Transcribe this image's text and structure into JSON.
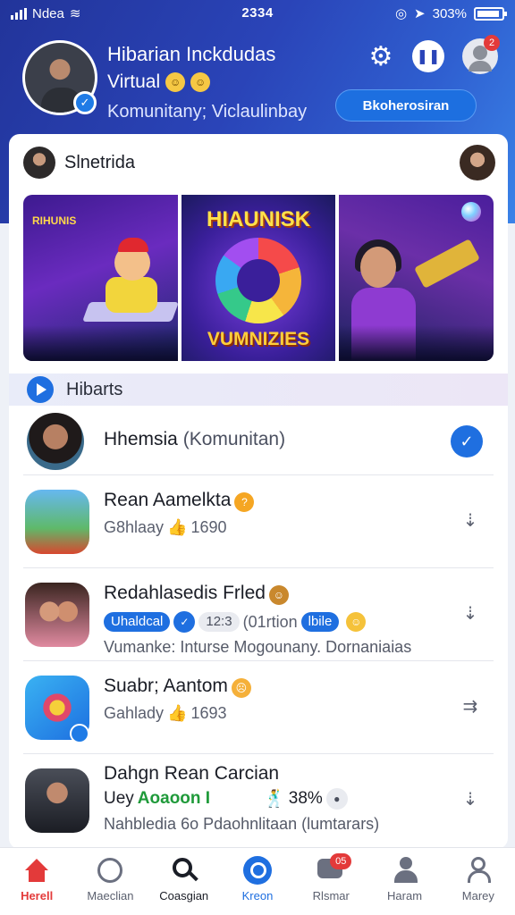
{
  "status": {
    "carrier": "Ndea",
    "time": "2334",
    "battery": "303%"
  },
  "profile": {
    "name": "Hibarian Inckdudas",
    "subtitle": "Virtual",
    "community": "Komunitany; Viclaulinbay",
    "action_label": "Bkoherosiran",
    "notification_count": "2"
  },
  "feed": {
    "author": "Slnetrida",
    "banner": {
      "panel1_label": "RIHUNIS",
      "panel2_title": "HIAUNISK",
      "panel2_subtitle": "VUMNIZIES"
    },
    "section_label": "Hibarts"
  },
  "list": [
    {
      "title": "Hhemsia",
      "title_muted": "(Komunitan)"
    },
    {
      "title": "Rean Aamelkta",
      "meta": "G8hlaay",
      "likes": "1690"
    },
    {
      "title": "Redahlasedis Frled",
      "chip1": "Uhaldcal",
      "chip2": "12:3",
      "meta": "(01rtion",
      "chip3": "lbile",
      "description": "Vumanke: Inturse Mogounany. Dornaniaias"
    },
    {
      "title": "Suabr; Aantom",
      "meta": "Gahlady",
      "likes": "1693"
    },
    {
      "title": "Dahgn Rean Carcian",
      "subtitle": "Uey",
      "green_tag": "Aoaoon I",
      "percent": "38%",
      "description": "Nahbledia 6o Pdaohnlitaan (lumtarars)"
    }
  ],
  "nav": [
    {
      "label": "Herell"
    },
    {
      "label": "Maeclian"
    },
    {
      "label": "Coasgian"
    },
    {
      "label": "Kreon"
    },
    {
      "label": "Rlsmar",
      "badge": "05"
    },
    {
      "label": "Haram"
    },
    {
      "label": "Marey"
    }
  ],
  "colors": {
    "header_start": "#22349a",
    "header_end": "#3a83e8",
    "accent": "#1f6fe0",
    "active": "#e33a3a"
  }
}
